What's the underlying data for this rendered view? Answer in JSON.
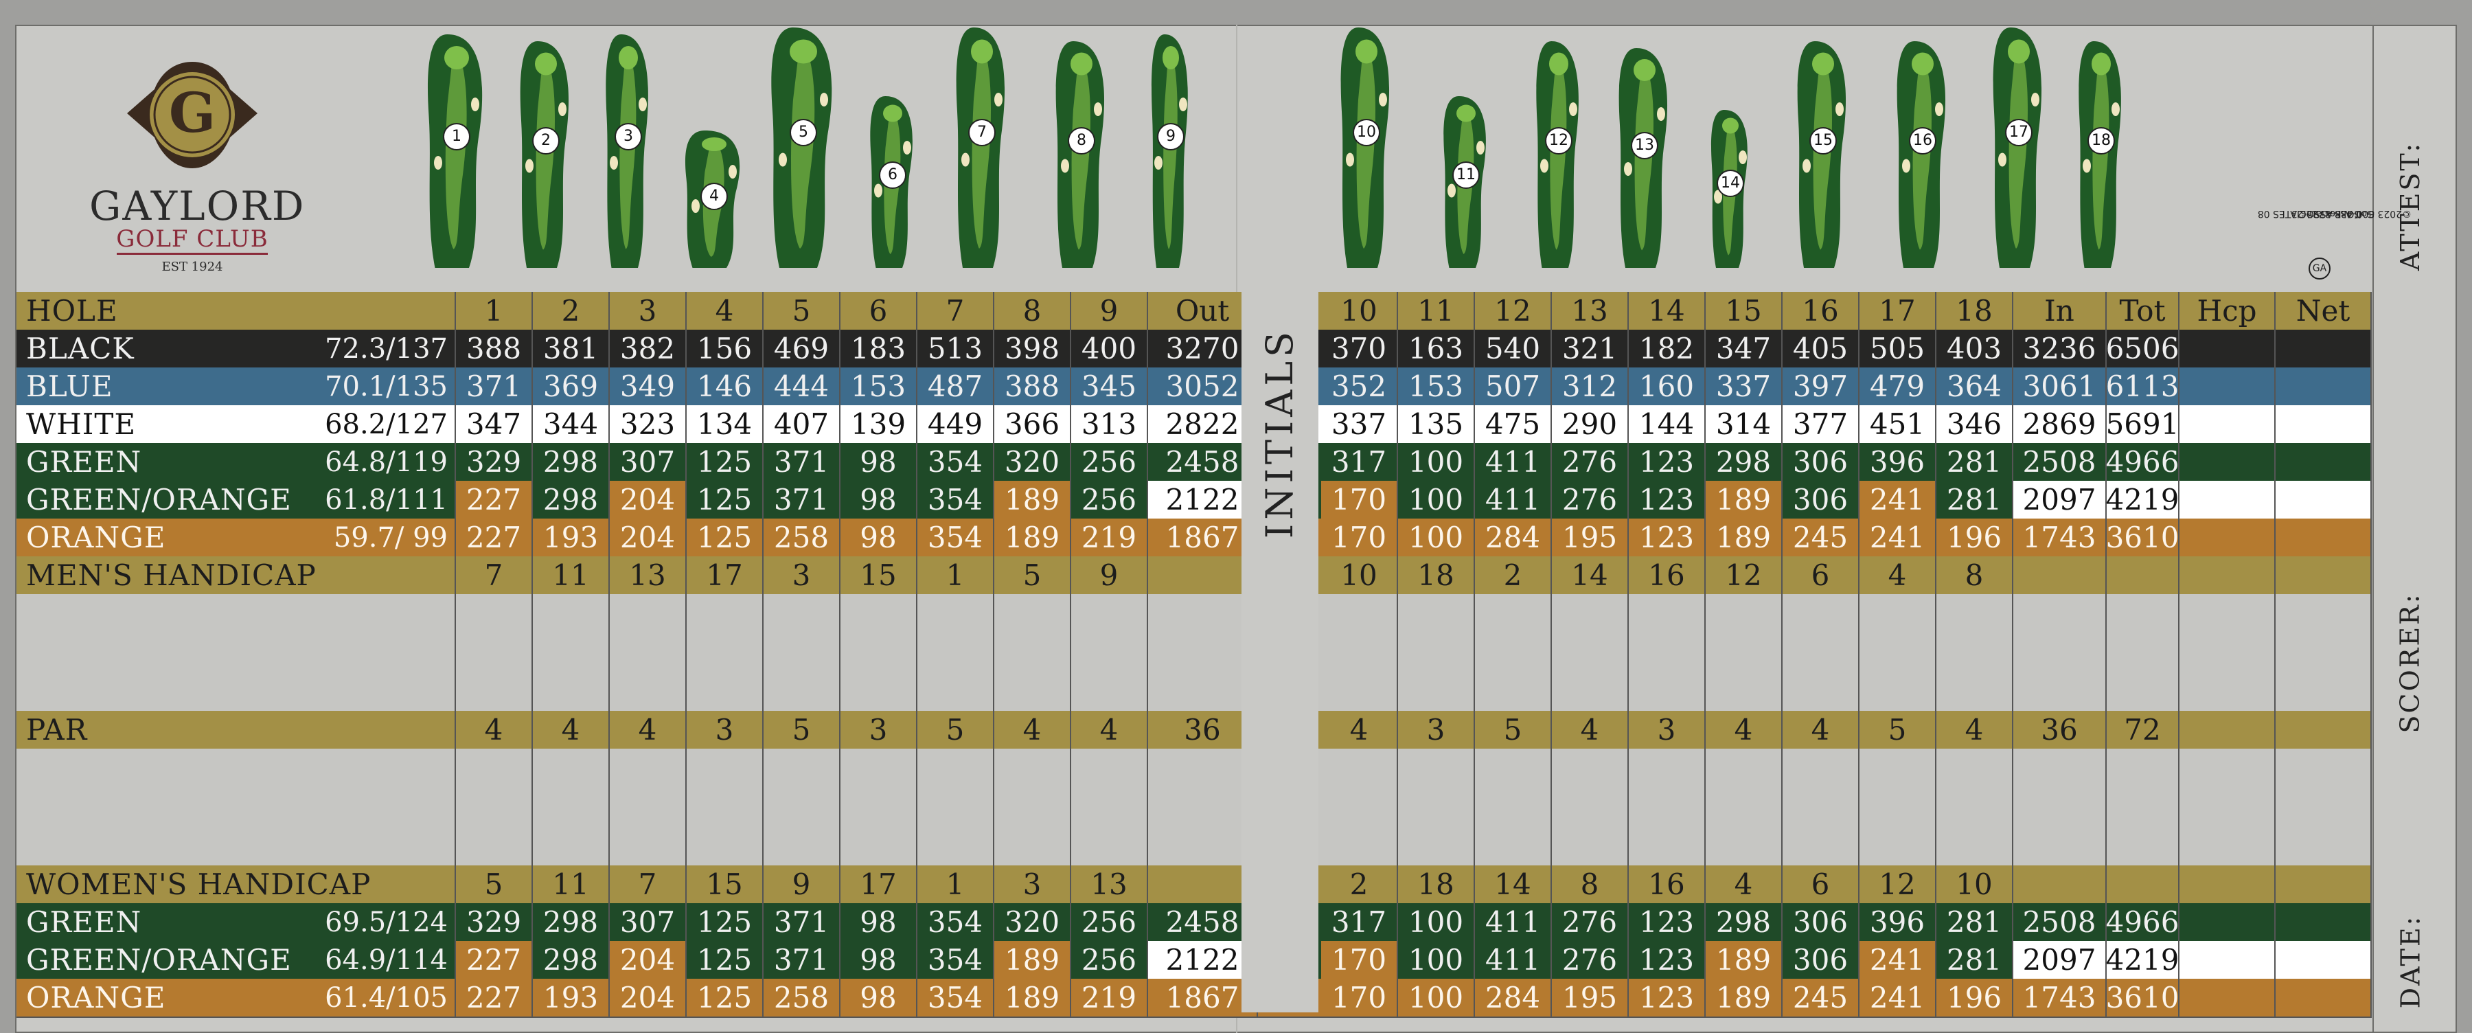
{
  "club": {
    "name": "GAYLORD",
    "sub": "GOLF CLUB",
    "est": "EST 1924",
    "monogram": "G"
  },
  "holes_numbers": [
    "1",
    "2",
    "3",
    "4",
    "5",
    "6",
    "7",
    "8",
    "9",
    "10",
    "11",
    "12",
    "13",
    "14",
    "15",
    "16",
    "17",
    "18"
  ],
  "columns": [
    "1",
    "2",
    "3",
    "4",
    "5",
    "6",
    "7",
    "8",
    "9",
    "Out",
    "10",
    "11",
    "12",
    "13",
    "14",
    "15",
    "16",
    "17",
    "18",
    "In",
    "Tot",
    "Hcp",
    "Net"
  ],
  "rows": [
    {
      "id": "hole",
      "label": "HOLE",
      "rating": "",
      "theme": "gold",
      "values": [
        "1",
        "2",
        "3",
        "4",
        "5",
        "6",
        "7",
        "8",
        "9",
        "Out",
        "10",
        "11",
        "12",
        "13",
        "14",
        "15",
        "16",
        "17",
        "18",
        "In",
        "Tot",
        "Hcp",
        "Net"
      ]
    },
    {
      "id": "black",
      "label": "BLACK",
      "rating": "72.3/137",
      "theme": "black",
      "values": [
        "388",
        "381",
        "382",
        "156",
        "469",
        "183",
        "513",
        "398",
        "400",
        "3270",
        "370",
        "163",
        "540",
        "321",
        "182",
        "347",
        "405",
        "505",
        "403",
        "3236",
        "6506",
        "",
        ""
      ]
    },
    {
      "id": "blue",
      "label": "BLUE",
      "rating": "70.1/135",
      "theme": "blue",
      "values": [
        "371",
        "369",
        "349",
        "146",
        "444",
        "153",
        "487",
        "388",
        "345",
        "3052",
        "352",
        "153",
        "507",
        "312",
        "160",
        "337",
        "397",
        "479",
        "364",
        "3061",
        "6113",
        "",
        ""
      ]
    },
    {
      "id": "white",
      "label": "WHITE",
      "rating": "68.2/127",
      "theme": "white",
      "values": [
        "347",
        "344",
        "323",
        "134",
        "407",
        "139",
        "449",
        "366",
        "313",
        "2822",
        "337",
        "135",
        "475",
        "290",
        "144",
        "314",
        "377",
        "451",
        "346",
        "2869",
        "5691",
        "",
        ""
      ]
    },
    {
      "id": "green",
      "label": "GREEN",
      "rating": "64.8/119",
      "theme": "green",
      "values": [
        "329",
        "298",
        "307",
        "125",
        "371",
        "98",
        "354",
        "320",
        "256",
        "2458",
        "317",
        "100",
        "411",
        "276",
        "123",
        "298",
        "306",
        "396",
        "281",
        "2508",
        "4966",
        "",
        ""
      ]
    },
    {
      "id": "green-orange",
      "label": "GREEN/ORANGE",
      "rating": "61.8/111",
      "theme": "green",
      "values": [
        "227",
        "298",
        "204",
        "125",
        "371",
        "98",
        "354",
        "189",
        "256",
        "2122",
        "170",
        "100",
        "411",
        "276",
        "123",
        "189",
        "306",
        "241",
        "281",
        "2097",
        "4219",
        "",
        ""
      ],
      "cell_themes": [
        "orange",
        "",
        "orange",
        "",
        "",
        "",
        "",
        "orange",
        "",
        "white",
        "orange",
        "",
        "",
        "",
        "",
        "orange",
        "",
        "orange",
        "",
        "white",
        "white",
        "white",
        "white"
      ]
    },
    {
      "id": "orange",
      "label": "ORANGE",
      "rating": "59.7/ 99",
      "theme": "orange",
      "values": [
        "227",
        "193",
        "204",
        "125",
        "258",
        "98",
        "354",
        "189",
        "219",
        "1867",
        "170",
        "100",
        "284",
        "195",
        "123",
        "189",
        "245",
        "241",
        "196",
        "1743",
        "3610",
        "",
        ""
      ]
    },
    {
      "id": "mens-hcp",
      "label": "MEN'S HANDICAP",
      "rating": "",
      "theme": "gold",
      "values": [
        "7",
        "11",
        "13",
        "17",
        "3",
        "15",
        "1",
        "5",
        "9",
        "",
        "10",
        "18",
        "2",
        "14",
        "16",
        "12",
        "6",
        "4",
        "8",
        "",
        "",
        "",
        ""
      ]
    },
    {
      "id": "blank1",
      "label": "",
      "rating": "",
      "theme": "grey",
      "values": [
        "",
        "",
        "",
        "",
        "",
        "",
        "",
        "",
        "",
        "",
        "",
        "",
        "",
        "",
        "",
        "",
        "",
        "",
        "",
        "",
        "",
        "",
        ""
      ]
    },
    {
      "id": "blank2",
      "label": "",
      "rating": "",
      "theme": "grey",
      "values": [
        "",
        "",
        "",
        "",
        "",
        "",
        "",
        "",
        "",
        "",
        "",
        "",
        "",
        "",
        "",
        "",
        "",
        "",
        "",
        "",
        "",
        "",
        ""
      ]
    },
    {
      "id": "par",
      "label": "PAR",
      "rating": "",
      "theme": "gold",
      "values": [
        "4",
        "4",
        "4",
        "3",
        "5",
        "3",
        "5",
        "4",
        "4",
        "36",
        "4",
        "3",
        "5",
        "4",
        "3",
        "4",
        "4",
        "5",
        "4",
        "36",
        "72",
        "",
        ""
      ]
    },
    {
      "id": "blank3",
      "label": "",
      "rating": "",
      "theme": "grey",
      "values": [
        "",
        "",
        "",
        "",
        "",
        "",
        "",
        "",
        "",
        "",
        "",
        "",
        "",
        "",
        "",
        "",
        "",
        "",
        "",
        "",
        "",
        "",
        ""
      ]
    },
    {
      "id": "blank4",
      "label": "",
      "rating": "",
      "theme": "grey",
      "values": [
        "",
        "",
        "",
        "",
        "",
        "",
        "",
        "",
        "",
        "",
        "",
        "",
        "",
        "",
        "",
        "",
        "",
        "",
        "",
        "",
        "",
        "",
        ""
      ]
    },
    {
      "id": "womens-hcp",
      "label": "WOMEN'S HANDICAP",
      "rating": "",
      "theme": "gold",
      "values": [
        "5",
        "11",
        "7",
        "15",
        "9",
        "17",
        "1",
        "3",
        "13",
        "",
        "2",
        "18",
        "14",
        "8",
        "16",
        "4",
        "6",
        "12",
        "10",
        "",
        "",
        "",
        ""
      ]
    },
    {
      "id": "w-green",
      "label": "GREEN",
      "rating": "69.5/124",
      "theme": "green",
      "values": [
        "329",
        "298",
        "307",
        "125",
        "371",
        "98",
        "354",
        "320",
        "256",
        "2458",
        "317",
        "100",
        "411",
        "276",
        "123",
        "298",
        "306",
        "396",
        "281",
        "2508",
        "4966",
        "",
        ""
      ]
    },
    {
      "id": "w-green-orange",
      "label": "GREEN/ORANGE",
      "rating": "64.9/114",
      "theme": "green",
      "values": [
        "227",
        "298",
        "204",
        "125",
        "371",
        "98",
        "354",
        "189",
        "256",
        "2122",
        "170",
        "100",
        "411",
        "276",
        "123",
        "189",
        "306",
        "241",
        "281",
        "2097",
        "4219",
        "",
        ""
      ],
      "cell_themes": [
        "orange",
        "",
        "orange",
        "",
        "",
        "",
        "",
        "orange",
        "",
        "white",
        "orange",
        "",
        "",
        "",
        "",
        "orange",
        "",
        "orange",
        "",
        "white",
        "white",
        "white",
        "white"
      ]
    },
    {
      "id": "w-orange",
      "label": "ORANGE",
      "rating": "61.4/105",
      "theme": "orange",
      "values": [
        "227",
        "193",
        "204",
        "125",
        "258",
        "98",
        "354",
        "189",
        "219",
        "1867",
        "170",
        "100",
        "284",
        "195",
        "123",
        "189",
        "245",
        "241",
        "196",
        "1743",
        "3610",
        "",
        ""
      ]
    }
  ],
  "initials": "INITIALS",
  "side_labels": {
    "attest": "ATTEST:",
    "scorer": "SCORER:",
    "date": "DATE:"
  },
  "printer": {
    "line1": "GOLF ASSOCIATES 08",
    "line2": "800-438-8725 23",
    "line3": "©2023 Golf Associates",
    "mark": "GA"
  },
  "colors": {
    "gold": "#a39046",
    "black": "#262625",
    "blue": "#3e6c8c",
    "white": "#ffffff",
    "green": "#1f4a28",
    "orange": "#b57a2f",
    "accent": "#8a2b3a"
  }
}
